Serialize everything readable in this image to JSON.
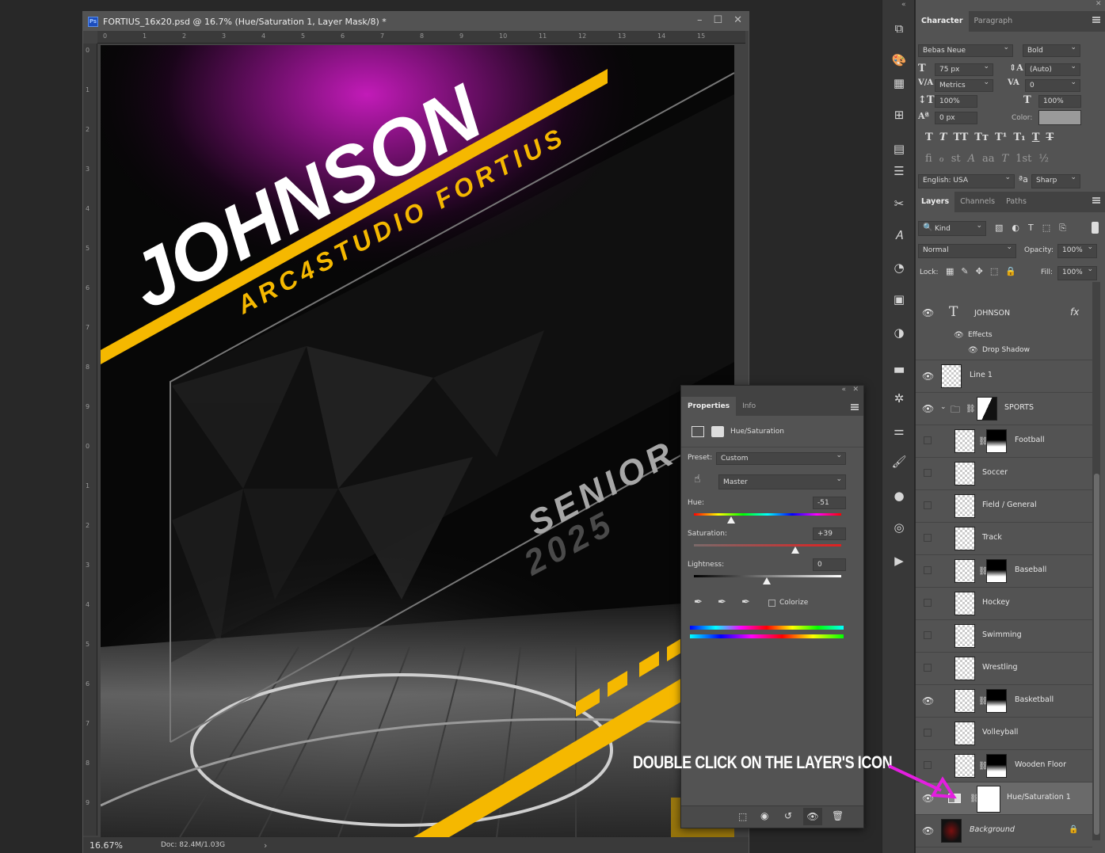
{
  "document": {
    "title": "FORTIUS_16x20.psd @ 16.7% (Hue/Saturation 1, Layer Mask/8) *",
    "ps_badge": "Ps",
    "ruler_top": [
      "0",
      "1",
      "2",
      "3",
      "4",
      "5",
      "6",
      "7",
      "8",
      "9",
      "10",
      "11",
      "12",
      "13",
      "14",
      "15"
    ],
    "ruler_left": [
      "0",
      "1",
      "2",
      "3",
      "4",
      "5",
      "6",
      "7",
      "8",
      "9",
      "0",
      "1",
      "2",
      "3",
      "4",
      "5",
      "6",
      "7",
      "8",
      "9"
    ],
    "zoom": "16.67%",
    "doc_size": "Doc: 82.4M/1.03G",
    "artwork": {
      "name": "JOHNSON",
      "studio": "ARC4STUDIO FORTIUS",
      "senior": "SENIOR",
      "year": "2025"
    }
  },
  "properties": {
    "tabs": [
      "Properties",
      "Info"
    ],
    "adjustment_title": "Hue/Saturation",
    "preset_label": "Preset:",
    "preset_value": "Custom",
    "channel_value": "Master",
    "hue_label": "Hue:",
    "hue_value": "-51",
    "saturation_label": "Saturation:",
    "saturation_value": "+39",
    "lightness_label": "Lightness:",
    "lightness_value": "0",
    "colorize_label": "Colorize",
    "colorize_checked": false
  },
  "character": {
    "tabs": [
      "Character",
      "Paragraph"
    ],
    "font_family": "Bebas Neue",
    "font_style": "Bold",
    "font_size": "75 px",
    "leading": "(Auto)",
    "kerning": "Metrics",
    "tracking": "0",
    "vertical_scale": "100%",
    "horizontal_scale": "100%",
    "baseline_shift": "0 px",
    "color_label": "Color:",
    "color_swatch": "#9a9a9a",
    "language": "English: USA",
    "antialias": "Sharp",
    "aa_icon": "ªa"
  },
  "layers_panel": {
    "tabs": [
      "Layers",
      "Channels",
      "Paths"
    ],
    "filter_kind": "Kind",
    "blend_mode": "Normal",
    "opacity_label": "Opacity:",
    "opacity_value": "100%",
    "lock_label": "Lock:",
    "fill_label": "Fill:",
    "fill_value": "100%",
    "text_layer_name": "JOHNSON",
    "fx_label": "fx",
    "effects_label": "Effects",
    "drop_shadow_label": "Drop Shadow",
    "layers": [
      {
        "name": "Line 1",
        "visible": true,
        "mask": false
      },
      {
        "name": "SPORTS",
        "visible": true,
        "group": true
      },
      {
        "name": "Football",
        "visible": false,
        "mask": true
      },
      {
        "name": "Soccer",
        "visible": false,
        "mask": false
      },
      {
        "name": "Field / General",
        "visible": false,
        "mask": false
      },
      {
        "name": "Track",
        "visible": false,
        "mask": false
      },
      {
        "name": "Baseball",
        "visible": false,
        "mask": true
      },
      {
        "name": "Hockey",
        "visible": false,
        "mask": false
      },
      {
        "name": "Swimming",
        "visible": false,
        "mask": false
      },
      {
        "name": "Wrestling",
        "visible": false,
        "mask": false
      },
      {
        "name": "Basketball",
        "visible": true,
        "mask": true
      },
      {
        "name": "Volleyball",
        "visible": false,
        "mask": false
      },
      {
        "name": "Wooden Floor",
        "visible": false,
        "mask": true
      },
      {
        "name": "Hue/Saturation 1",
        "visible": true,
        "adjustment": true
      },
      {
        "name": "Background",
        "visible": true,
        "locked": true
      }
    ]
  },
  "annotation": {
    "text": "DOUBLE CLICK ON THE LAYER'S ICON",
    "color": "#e41ee0"
  }
}
